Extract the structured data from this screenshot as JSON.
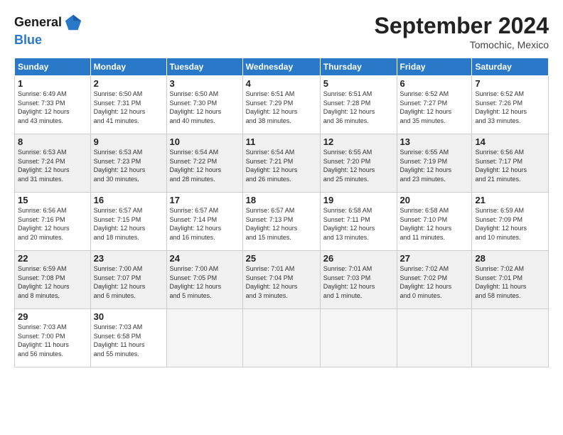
{
  "header": {
    "logo_line1": "General",
    "logo_line2": "Blue",
    "month_title": "September 2024",
    "location": "Tomochic, Mexico"
  },
  "weekdays": [
    "Sunday",
    "Monday",
    "Tuesday",
    "Wednesday",
    "Thursday",
    "Friday",
    "Saturday"
  ],
  "weeks": [
    [
      {
        "day": "1",
        "info": "Sunrise: 6:49 AM\nSunset: 7:33 PM\nDaylight: 12 hours\nand 43 minutes."
      },
      {
        "day": "2",
        "info": "Sunrise: 6:50 AM\nSunset: 7:31 PM\nDaylight: 12 hours\nand 41 minutes."
      },
      {
        "day": "3",
        "info": "Sunrise: 6:50 AM\nSunset: 7:30 PM\nDaylight: 12 hours\nand 40 minutes."
      },
      {
        "day": "4",
        "info": "Sunrise: 6:51 AM\nSunset: 7:29 PM\nDaylight: 12 hours\nand 38 minutes."
      },
      {
        "day": "5",
        "info": "Sunrise: 6:51 AM\nSunset: 7:28 PM\nDaylight: 12 hours\nand 36 minutes."
      },
      {
        "day": "6",
        "info": "Sunrise: 6:52 AM\nSunset: 7:27 PM\nDaylight: 12 hours\nand 35 minutes."
      },
      {
        "day": "7",
        "info": "Sunrise: 6:52 AM\nSunset: 7:26 PM\nDaylight: 12 hours\nand 33 minutes."
      }
    ],
    [
      {
        "day": "8",
        "info": "Sunrise: 6:53 AM\nSunset: 7:24 PM\nDaylight: 12 hours\nand 31 minutes."
      },
      {
        "day": "9",
        "info": "Sunrise: 6:53 AM\nSunset: 7:23 PM\nDaylight: 12 hours\nand 30 minutes."
      },
      {
        "day": "10",
        "info": "Sunrise: 6:54 AM\nSunset: 7:22 PM\nDaylight: 12 hours\nand 28 minutes."
      },
      {
        "day": "11",
        "info": "Sunrise: 6:54 AM\nSunset: 7:21 PM\nDaylight: 12 hours\nand 26 minutes."
      },
      {
        "day": "12",
        "info": "Sunrise: 6:55 AM\nSunset: 7:20 PM\nDaylight: 12 hours\nand 25 minutes."
      },
      {
        "day": "13",
        "info": "Sunrise: 6:55 AM\nSunset: 7:19 PM\nDaylight: 12 hours\nand 23 minutes."
      },
      {
        "day": "14",
        "info": "Sunrise: 6:56 AM\nSunset: 7:17 PM\nDaylight: 12 hours\nand 21 minutes."
      }
    ],
    [
      {
        "day": "15",
        "info": "Sunrise: 6:56 AM\nSunset: 7:16 PM\nDaylight: 12 hours\nand 20 minutes."
      },
      {
        "day": "16",
        "info": "Sunrise: 6:57 AM\nSunset: 7:15 PM\nDaylight: 12 hours\nand 18 minutes."
      },
      {
        "day": "17",
        "info": "Sunrise: 6:57 AM\nSunset: 7:14 PM\nDaylight: 12 hours\nand 16 minutes."
      },
      {
        "day": "18",
        "info": "Sunrise: 6:57 AM\nSunset: 7:13 PM\nDaylight: 12 hours\nand 15 minutes."
      },
      {
        "day": "19",
        "info": "Sunrise: 6:58 AM\nSunset: 7:11 PM\nDaylight: 12 hours\nand 13 minutes."
      },
      {
        "day": "20",
        "info": "Sunrise: 6:58 AM\nSunset: 7:10 PM\nDaylight: 12 hours\nand 11 minutes."
      },
      {
        "day": "21",
        "info": "Sunrise: 6:59 AM\nSunset: 7:09 PM\nDaylight: 12 hours\nand 10 minutes."
      }
    ],
    [
      {
        "day": "22",
        "info": "Sunrise: 6:59 AM\nSunset: 7:08 PM\nDaylight: 12 hours\nand 8 minutes."
      },
      {
        "day": "23",
        "info": "Sunrise: 7:00 AM\nSunset: 7:07 PM\nDaylight: 12 hours\nand 6 minutes."
      },
      {
        "day": "24",
        "info": "Sunrise: 7:00 AM\nSunset: 7:05 PM\nDaylight: 12 hours\nand 5 minutes."
      },
      {
        "day": "25",
        "info": "Sunrise: 7:01 AM\nSunset: 7:04 PM\nDaylight: 12 hours\nand 3 minutes."
      },
      {
        "day": "26",
        "info": "Sunrise: 7:01 AM\nSunset: 7:03 PM\nDaylight: 12 hours\nand 1 minute."
      },
      {
        "day": "27",
        "info": "Sunrise: 7:02 AM\nSunset: 7:02 PM\nDaylight: 12 hours\nand 0 minutes."
      },
      {
        "day": "28",
        "info": "Sunrise: 7:02 AM\nSunset: 7:01 PM\nDaylight: 11 hours\nand 58 minutes."
      }
    ],
    [
      {
        "day": "29",
        "info": "Sunrise: 7:03 AM\nSunset: 7:00 PM\nDaylight: 11 hours\nand 56 minutes."
      },
      {
        "day": "30",
        "info": "Sunrise: 7:03 AM\nSunset: 6:58 PM\nDaylight: 11 hours\nand 55 minutes."
      },
      null,
      null,
      null,
      null,
      null
    ]
  ]
}
